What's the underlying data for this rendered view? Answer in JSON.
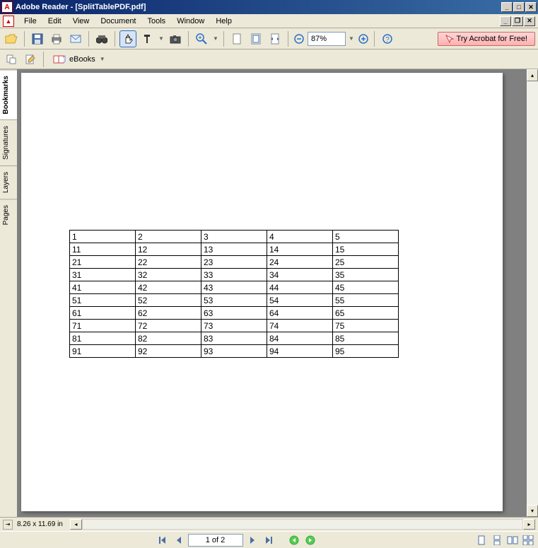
{
  "titlebar": {
    "app_name": "Adobe Reader",
    "document": "[SplitTablePDF.pdf]"
  },
  "menubar": {
    "items": [
      "File",
      "Edit",
      "View",
      "Document",
      "Tools",
      "Window",
      "Help"
    ]
  },
  "toolbar": {
    "zoom_value": "87%",
    "acrobat_promo": "Try Acrobat for Free!",
    "ebooks_label": "eBooks"
  },
  "sidebar": {
    "tabs": [
      "Bookmarks",
      "Signatures",
      "Layers",
      "Pages"
    ]
  },
  "table": {
    "rows": [
      [
        "1",
        "2",
        "3",
        "4",
        "5"
      ],
      [
        "11",
        "12",
        "13",
        "14",
        "15"
      ],
      [
        "21",
        "22",
        "23",
        "24",
        "25"
      ],
      [
        "31",
        "32",
        "33",
        "34",
        "35"
      ],
      [
        "41",
        "42",
        "43",
        "44",
        "45"
      ],
      [
        "51",
        "52",
        "53",
        "54",
        "55"
      ],
      [
        "61",
        "62",
        "63",
        "64",
        "65"
      ],
      [
        "71",
        "72",
        "73",
        "74",
        "75"
      ],
      [
        "81",
        "82",
        "83",
        "84",
        "85"
      ],
      [
        "91",
        "92",
        "93",
        "94",
        "95"
      ]
    ]
  },
  "statusbar": {
    "page_size": "8.26 x 11.69 in"
  },
  "navbar": {
    "page_indicator": "1 of 2"
  }
}
